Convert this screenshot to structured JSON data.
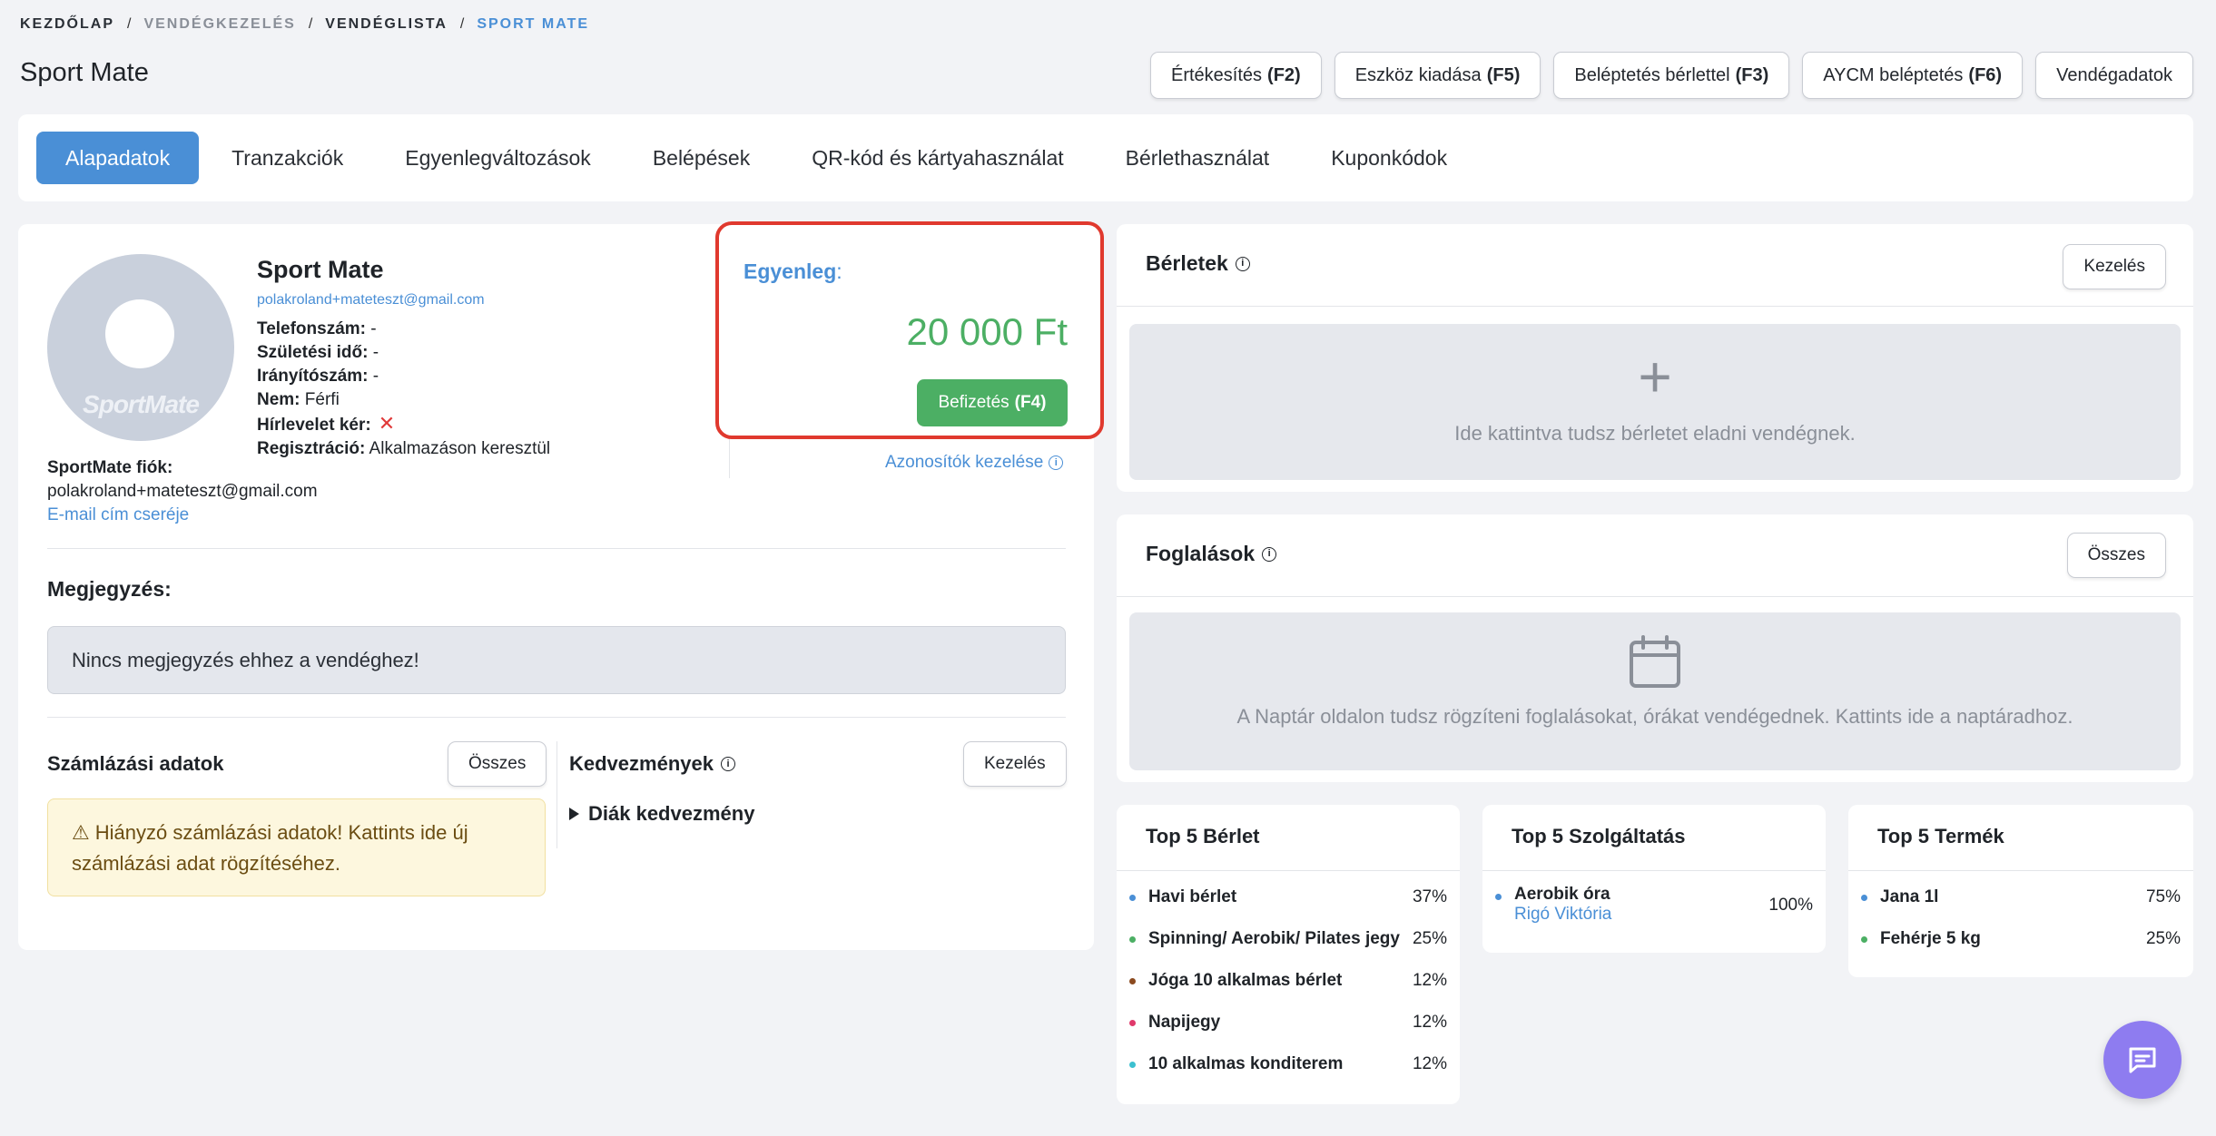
{
  "breadcrumb": {
    "home": "KEZDŐLAP",
    "guest_mgmt": "VENDÉGKEZELÉS",
    "guest_list": "VENDÉGLISTA",
    "current": "SPORT MATE",
    "sep": "/"
  },
  "page": {
    "title": "Sport Mate"
  },
  "header_buttons": [
    {
      "label": "Értékesítés",
      "key": "(F2)"
    },
    {
      "label": "Eszköz kiadása",
      "key": "(F5)"
    },
    {
      "label": "Beléptetés bérlettel",
      "key": "(F3)"
    },
    {
      "label": "AYCM beléptetés",
      "key": "(F6)"
    },
    {
      "label": "Vendégadatok",
      "key": ""
    }
  ],
  "tabs": [
    "Alapadatok",
    "Tranzakciók",
    "Egyenlegváltozások",
    "Belépések",
    "QR-kód és kártyahasználat",
    "Bérlethasználat",
    "Kuponkódok"
  ],
  "profile": {
    "name": "Sport Mate",
    "email": "polakroland+mateteszt@gmail.com",
    "avatar_logo": "SportMate",
    "phone_label": "Telefonszám:",
    "phone": "-",
    "birth_label": "Születési idő:",
    "birth": "-",
    "zip_label": "Irányítószám:",
    "zip": "-",
    "gender_label": "Nem:",
    "gender": "Férfi",
    "newsletter_label": "Hírlevelet kér:",
    "reg_label": "Regisztráció:",
    "reg": "Alkalmazáson keresztül",
    "account_label": "SportMate fiók:",
    "account_email": "polakroland+mateteszt@gmail.com",
    "change_email": "E-mail cím cseréje"
  },
  "balance": {
    "label": "Egyenleg",
    "colon": ":",
    "value": "20 000 Ft",
    "pay_label": "Befizetés",
    "pay_key": "(F4)"
  },
  "identifiers_link": "Azonosítók kezelése",
  "note": {
    "title": "Megjegyzés:",
    "text": "Nincs megjegyzés ehhez a vendéghez!"
  },
  "billing": {
    "title": "Számlázási adatok",
    "button": "Összes",
    "warning": "Hiányzó számlázási adatok! Kattints ide új számlázási adat rögzítéséhez."
  },
  "discounts": {
    "title": "Kedvezmények",
    "button": "Kezelés",
    "item": "Diák kedvezmény"
  },
  "passes": {
    "title": "Bérletek",
    "button": "Kezelés",
    "empty": "Ide kattintva tudsz bérletet eladni vendégnek."
  },
  "bookings": {
    "title": "Foglalások",
    "button": "Összes",
    "empty": "A Naptár oldalon tudsz rögzíteni foglalásokat, órákat vendégednek. Kattints ide a naptáradhoz."
  },
  "top_passes": {
    "title": "Top 5 Bérlet",
    "items": [
      {
        "name": "Havi bérlet",
        "pct": "37%",
        "color": "#4a8fd6"
      },
      {
        "name": "Spinning/ Aerobik/ Pilates jegy",
        "pct": "25%",
        "color": "#4caf64"
      },
      {
        "name": "Jóga 10 alkalmas bérlet",
        "pct": "12%",
        "color": "#8b4a1f"
      },
      {
        "name": "Napijegy",
        "pct": "12%",
        "color": "#e0396b"
      },
      {
        "name": "10 alkalmas konditerem",
        "pct": "12%",
        "color": "#3cc0d0"
      }
    ]
  },
  "top_services": {
    "title": "Top 5 Szolgáltatás",
    "items": [
      {
        "name": "Aerobik óra",
        "sub": "Rigó Viktória",
        "pct": "100%",
        "color": "#4a8fd6"
      }
    ]
  },
  "top_products": {
    "title": "Top 5 Termék",
    "items": [
      {
        "name": "Jana 1l",
        "pct": "75%",
        "color": "#4a8fd6"
      },
      {
        "name": "Fehérje 5 kg",
        "pct": "25%",
        "color": "#4caf64"
      }
    ]
  },
  "colors": {
    "accent": "#4a8fd6",
    "success": "#4caf64",
    "highlight": "#e0392e",
    "chat": "#8e7cf0"
  }
}
